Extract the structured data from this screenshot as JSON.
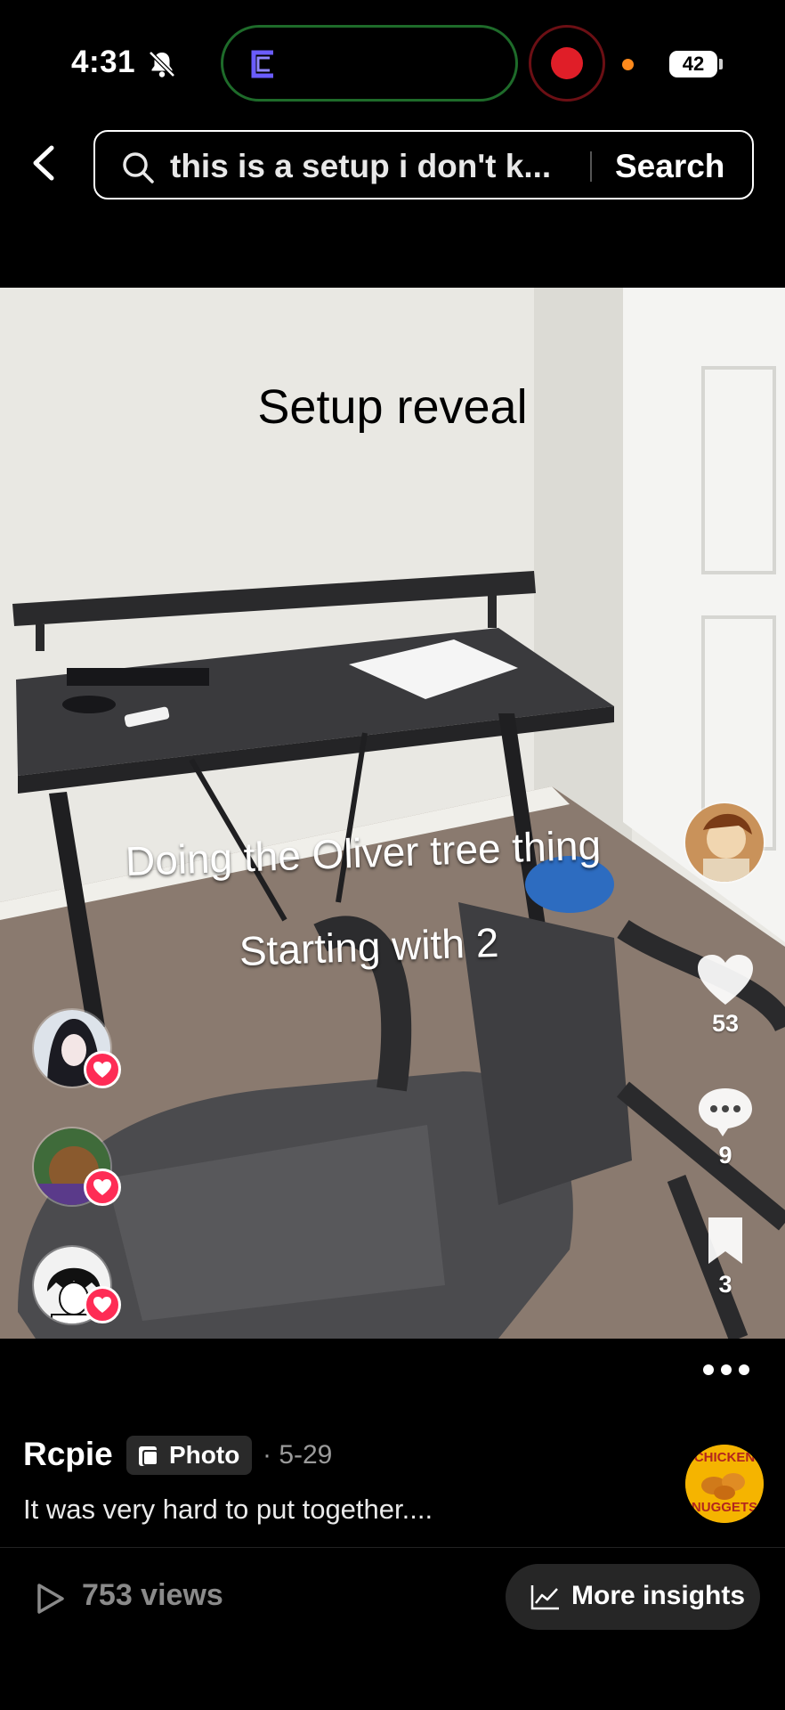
{
  "status_bar": {
    "time": "4:31",
    "battery": "42",
    "icons": [
      "bell-off-icon",
      "app-icon",
      "record-icon",
      "privacy-dot-icon",
      "battery-icon"
    ]
  },
  "header": {
    "back_icon": "chevron-left-icon",
    "search_icon": "search-icon",
    "search_query": "this is a setup i don't k...",
    "search_button": "Search"
  },
  "photo": {
    "title": "Setup reveal",
    "caption_1": "Doing the Oliver tree thing",
    "caption_2": "Starting with 2"
  },
  "actions": {
    "likes": "53",
    "comments": "9",
    "saves": "3",
    "icons": [
      "heart-icon",
      "comment-icon",
      "bookmark-icon"
    ]
  },
  "post": {
    "author": "Rcpie",
    "badge": "Photo",
    "date": "· 5-29",
    "description": "It was very hard to put together....",
    "music_label_top": "CHICKEN",
    "music_label_bottom": "NUGGETS"
  },
  "footer": {
    "views": "753 views",
    "insights_button": "More insights"
  },
  "colors": {
    "background": "#000000",
    "like_red": "#fe2c55",
    "record_red": "#e01e28",
    "privacy_orange": "#ff8a1c",
    "muted_text": "#8a8a8a"
  }
}
